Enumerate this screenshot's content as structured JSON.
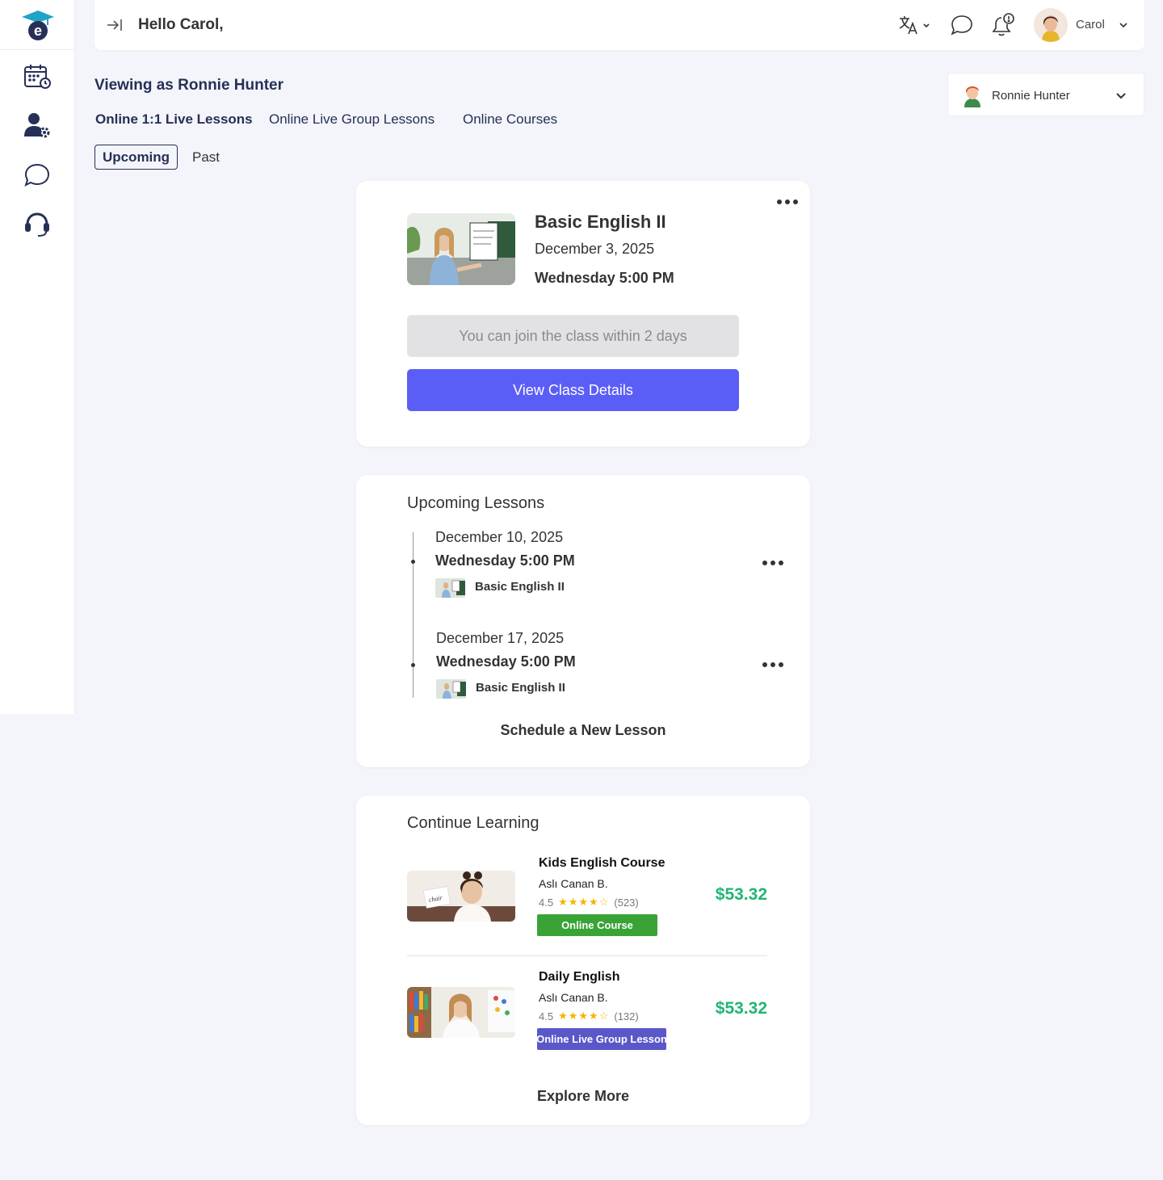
{
  "app": {
    "logo_letter": "e"
  },
  "header": {
    "greeting": "Hello Carol,",
    "user_name": "Carol"
  },
  "viewing": {
    "label": "Viewing as Ronnie Hunter",
    "student_name": "Ronnie Hunter"
  },
  "tabs": [
    {
      "label": "Online  1:1 Live Lessons",
      "active": true
    },
    {
      "label": "Online Live Group Lessons",
      "active": false
    },
    {
      "label": "Online Courses",
      "active": false
    }
  ],
  "subtabs": {
    "upcoming": "Upcoming",
    "past": "Past"
  },
  "next_lesson": {
    "title": "Basic English II",
    "date": "December 3, 2025",
    "time": "Wednesday 5:00 PM",
    "join_notice": "You can join the class within 2 days",
    "button": "View Class Details"
  },
  "upcoming": {
    "heading": "Upcoming Lessons",
    "items": [
      {
        "date": "December 10, 2025",
        "time": "Wednesday 5:00 PM",
        "course": "Basic English II"
      },
      {
        "date": "December 17, 2025",
        "time": "Wednesday 5:00 PM",
        "course": "Basic English II"
      }
    ],
    "schedule_link": "Schedule a New Lesson"
  },
  "continue_learning": {
    "heading": "Continue Learning",
    "items": [
      {
        "title": "Kids English Course",
        "author": "Aslı Canan B.",
        "rating": "4.5",
        "stars": "★★★★☆",
        "reviews": "(523)",
        "badge": "Online Course",
        "badge_color": "#3aa336",
        "price": "$53.32",
        "flashcard_word": "chair"
      },
      {
        "title": "Daily English",
        "author": "Aslı Canan B.",
        "rating": "4.5",
        "stars": "★★★★☆",
        "reviews": "(132)",
        "badge": "Online Live Group Lesson",
        "badge_color": "#5a57c9",
        "price": "$53.32"
      }
    ],
    "explore": "Explore More"
  },
  "colors": {
    "primary": "#5b5ef6",
    "navy": "#263057",
    "price": "#22b573",
    "logo_teal": "#1fa3c7"
  }
}
